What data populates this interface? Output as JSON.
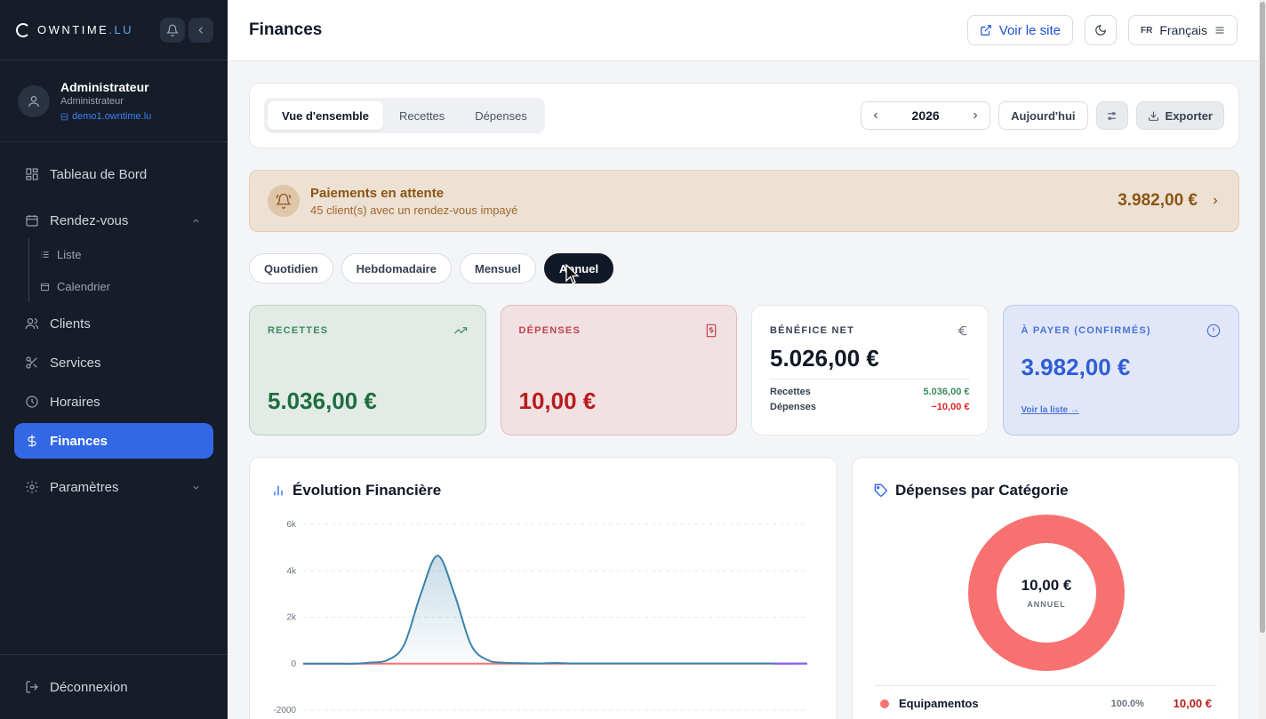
{
  "brand": {
    "name": "OWNTIME",
    "tld": ".LU"
  },
  "profile": {
    "name": "Administrateur",
    "role": "Administrateur",
    "host": "demo1.owntime.lu"
  },
  "nav": {
    "dashboard": "Tableau de Bord",
    "appointments": "Rendez-vous",
    "list": "Liste",
    "calendar": "Calendrier",
    "clients": "Clients",
    "services": "Services",
    "hours": "Horaires",
    "finances": "Finances",
    "settings": "Paramètres",
    "logout": "Déconnexion"
  },
  "header": {
    "title": "Finances",
    "view_site": "Voir le site",
    "lang_code": "FR",
    "lang": "Français"
  },
  "toolbar": {
    "tabs": [
      "Vue d'ensemble",
      "Recettes",
      "Dépenses"
    ],
    "year": "2026",
    "today": "Aujourd'hui",
    "export": "Exporter"
  },
  "alert": {
    "title": "Paiements en attente",
    "subtitle": "45 client(s) avec un rendez-vous impayé",
    "amount": "3.982,00 €"
  },
  "periods": [
    "Quotidien",
    "Hebdomadaire",
    "Mensuel",
    "Annuel"
  ],
  "cards": {
    "income": {
      "label": "RECETTES",
      "value": "5.036,00 €"
    },
    "expenses": {
      "label": "DÉPENSES",
      "value": "10,00 €"
    },
    "net": {
      "label": "BÉNÉFICE NET",
      "value": "5.026,00 €",
      "income_label": "Recettes",
      "income_value": "5.036,00 €",
      "expense_label": "Dépenses",
      "expense_value": "−10,00 €"
    },
    "topay": {
      "label": "À PAYER (CONFIRMÉS)",
      "value": "3.982,00 €",
      "link": "Voir la liste →"
    }
  },
  "evolution": {
    "title": "Évolution Financière"
  },
  "category": {
    "title": "Dépenses par Catégorie",
    "center_value": "10,00 €",
    "center_label": "ANNUEL",
    "items": [
      {
        "name": "Equipamentos",
        "pct": "100.0%",
        "amount": "10,00 €"
      }
    ]
  },
  "colors": {
    "accent": "#3268e6",
    "income": "#3b82a8",
    "expense": "#f87171"
  },
  "chart_data": {
    "type": "area",
    "title": "Évolution Financière",
    "ylim": [
      -2000,
      6000
    ],
    "yticks": [
      6000,
      4000,
      2000,
      0,
      -2000
    ],
    "ytick_labels": [
      "6k",
      "4k",
      "2k",
      "0",
      "-2000"
    ],
    "grid": true,
    "x": [
      0,
      1,
      2,
      3,
      4,
      5,
      6,
      7,
      8,
      9,
      10,
      11,
      12,
      13,
      14,
      15,
      16,
      17,
      18,
      19,
      20,
      21,
      22,
      23,
      24,
      25,
      26,
      27,
      28,
      29,
      30
    ],
    "series": [
      {
        "values": [
          0,
          0,
          0,
          0,
          50,
          150,
          800,
          3000,
          4650,
          3000,
          800,
          150,
          40,
          20,
          10,
          30,
          10,
          10,
          10,
          10,
          10,
          10,
          10,
          10,
          10,
          10,
          10,
          10,
          10,
          10,
          10
        ]
      },
      {
        "values": [
          0,
          0,
          0,
          0,
          0,
          0,
          0,
          0,
          0,
          0,
          0,
          0,
          0,
          0,
          0,
          0,
          0,
          0,
          0,
          0,
          0,
          0,
          0,
          0,
          0,
          0,
          0,
          0,
          0,
          0,
          10
        ]
      }
    ]
  }
}
